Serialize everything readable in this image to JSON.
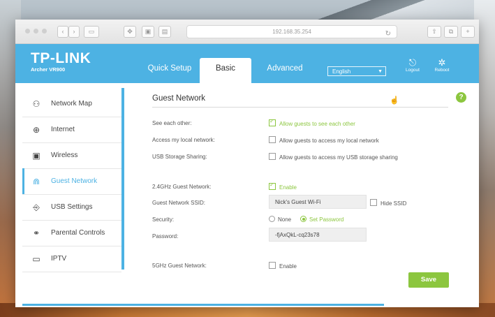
{
  "browser": {
    "address": "192.168.35.254",
    "reload_icon": "reload-icon"
  },
  "header": {
    "brand": "TP-LINK",
    "model": "Archer VR900",
    "tabs": [
      {
        "label": "Quick Setup"
      },
      {
        "label": "Basic"
      },
      {
        "label": "Advanced"
      }
    ],
    "language": "English",
    "logout_label": "Logout",
    "reboot_label": "Reboot",
    "accent_color": "#4db2e3"
  },
  "sidebar": {
    "items": [
      {
        "label": "Network Map",
        "icon": "network-map-icon"
      },
      {
        "label": "Internet",
        "icon": "globe-icon"
      },
      {
        "label": "Wireless",
        "icon": "wireless-icon"
      },
      {
        "label": "Guest Network",
        "icon": "guest-network-icon"
      },
      {
        "label": "USB Settings",
        "icon": "usb-icon"
      },
      {
        "label": "Parental Controls",
        "icon": "parental-controls-icon"
      },
      {
        "label": "IPTV",
        "icon": "iptv-icon"
      }
    ]
  },
  "main": {
    "title": "Guest Network",
    "see_each_other_label": "See each other:",
    "see_each_other_text": "Allow guests to see each other",
    "local_network_label": "Access my local network:",
    "local_network_text": "Allow guests to access my local network",
    "usb_label": "USB Storage Sharing:",
    "usb_text": "Allow guests to access my USB storage sharing",
    "guest24_label": "2.4GHz Guest Network:",
    "guest24_enable": "Enable",
    "ssid_label": "Guest Network SSID:",
    "ssid_value": "Nick's Guest Wi-Fi",
    "hide_ssid": "Hide SSID",
    "security_label": "Security:",
    "security_none": "None",
    "security_set": "Set Password",
    "password_label": "Password:",
    "password_value": "-fjAxQkL-cq23s78",
    "guest5_label": "5GHz Guest Network:",
    "guest5_enable": "Enable",
    "save_label": "Save",
    "help_label": "?",
    "status_color": "#8cc63f"
  }
}
